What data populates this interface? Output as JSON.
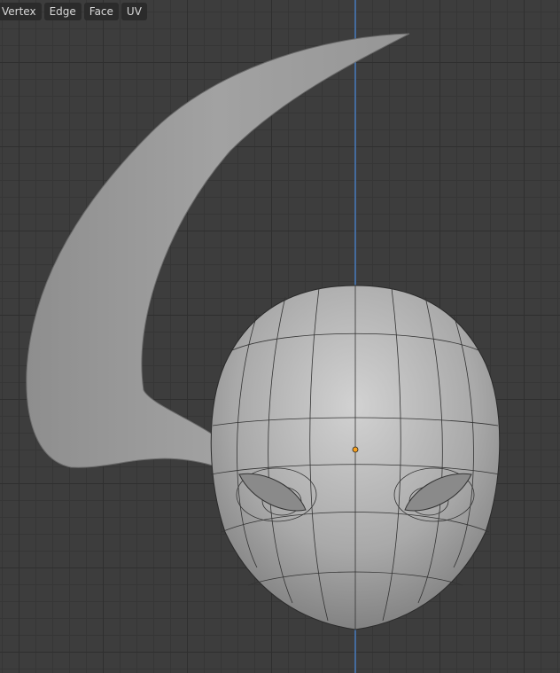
{
  "header": {
    "menu": [
      "Vertex",
      "Edge",
      "Face",
      "UV"
    ]
  },
  "colors": {
    "axis": "#4a7fc0",
    "origin": "#f5a020",
    "mesh": "#a8a8a8"
  }
}
